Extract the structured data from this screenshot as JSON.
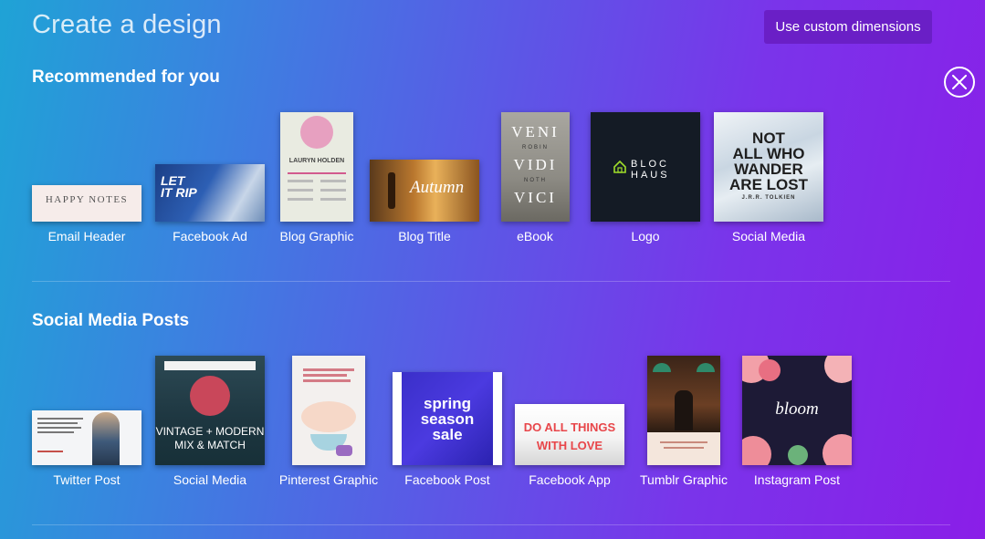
{
  "header": {
    "title": "Create a design",
    "custom_button": "Use custom dimensions"
  },
  "recommended": {
    "title": "Recommended for you",
    "items": [
      {
        "label": "Email Header",
        "thumb_text": "HAPPY NOTES"
      },
      {
        "label": "Facebook Ad",
        "thumb_text": "LET IT RIP"
      },
      {
        "label": "Blog Graphic",
        "thumb_text": "LAURYN HOLDEN"
      },
      {
        "label": "Blog Title",
        "thumb_text": "Autumn"
      },
      {
        "label": "eBook",
        "thumb_lines": [
          "VENI",
          "ROBIN",
          "VIDI",
          "NOTH",
          "VICI"
        ]
      },
      {
        "label": "Logo",
        "thumb_lines": [
          "BLOC",
          "HAUS"
        ]
      },
      {
        "label": "Social Media",
        "thumb_lines": [
          "NOT",
          "ALL WHO",
          "WANDER",
          "ARE LOST",
          "J.R.R. TOLKIEN"
        ]
      }
    ]
  },
  "social": {
    "title": "Social Media Posts",
    "items": [
      {
        "label": "Twitter Post"
      },
      {
        "label": "Social Media",
        "thumb_lines": [
          "VINTAGE + MODERN",
          "MIX & MATCH"
        ]
      },
      {
        "label": "Pinterest Graphic"
      },
      {
        "label": "Facebook Post",
        "thumb_lines": [
          "spring",
          "season",
          "sale"
        ]
      },
      {
        "label": "Facebook App",
        "thumb_lines": [
          "DO ALL THINGS",
          "WITH LOVE"
        ]
      },
      {
        "label": "Tumblr Graphic"
      },
      {
        "label": "Instagram Post",
        "thumb_text": "bloom"
      }
    ]
  }
}
